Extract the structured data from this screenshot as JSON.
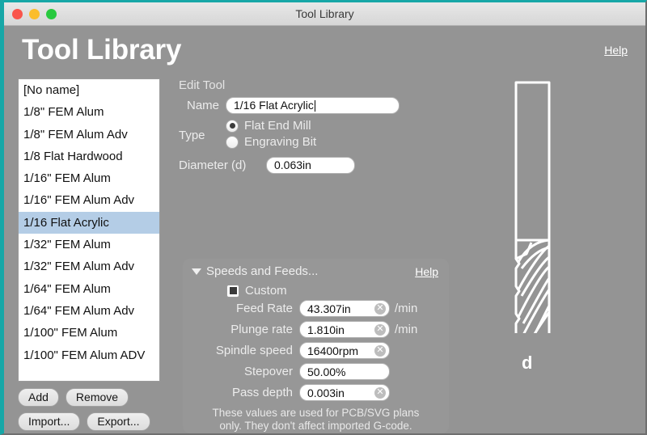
{
  "window": {
    "title": "Tool Library",
    "traffic_lights": [
      "close-red",
      "minimize-yellow",
      "zoom-green"
    ]
  },
  "header": {
    "app_title": "Tool Library",
    "help_label": "Help"
  },
  "tool_list": {
    "items": [
      "[No name]",
      "1/8\" FEM Alum",
      "1/8\" FEM Alum Adv",
      "1/8 Flat Hardwood",
      "1/16\" FEM Alum",
      "1/16\" FEM Alum Adv",
      "1/16 Flat Acrylic",
      "1/32\" FEM Alum",
      "1/32\" FEM Alum Adv",
      "1/64\" FEM Alum",
      "1/64\" FEM Alum Adv",
      "1/100\" FEM Alum",
      "1/100\" FEM Alum ADV"
    ],
    "selected_index": 6,
    "selection_color": "#b4cde6"
  },
  "list_buttons": {
    "add": "Add",
    "remove": "Remove",
    "import": "Import...",
    "export": "Export..."
  },
  "edit_tool": {
    "section_title": "Edit Tool",
    "name_label": "Name",
    "name_value": "1/16 Flat Acrylic",
    "type_label": "Type",
    "type_options": [
      {
        "label": "Flat End Mill",
        "selected": true
      },
      {
        "label": "Engraving Bit",
        "selected": false
      }
    ],
    "diameter_label": "Diameter (d)",
    "diameter_value": "0.063in"
  },
  "speeds_and_feeds": {
    "title": "Speeds and Feeds...",
    "disclosure": "expanded",
    "help_label": "Help",
    "custom_label": "Custom",
    "custom_checked": true,
    "fields": [
      {
        "label": "Feed Rate",
        "value": "43.307in",
        "unit": "/min",
        "clearable": true
      },
      {
        "label": "Plunge rate",
        "value": "1.810in",
        "unit": "/min",
        "clearable": true
      },
      {
        "label": "Spindle speed",
        "value": "16400rpm",
        "unit": "",
        "clearable": true
      },
      {
        "label": "Stepover",
        "value": "50.00%",
        "unit": "",
        "clearable": false
      },
      {
        "label": "Pass depth",
        "value": "0.003in",
        "unit": "",
        "clearable": true
      }
    ],
    "note_line_1": "These values are used for PCB/SVG plans",
    "note_line_2": "only. They don't affect imported G-code."
  },
  "illustration": {
    "dimension_label": "d",
    "description": "flat-end-mill-diagram"
  },
  "colors": {
    "window_background": "#949494",
    "panel_background": "#979797",
    "accent_border": "#17a7a7",
    "titlebar": "#e0e0e0",
    "text_light": "#ececec"
  }
}
